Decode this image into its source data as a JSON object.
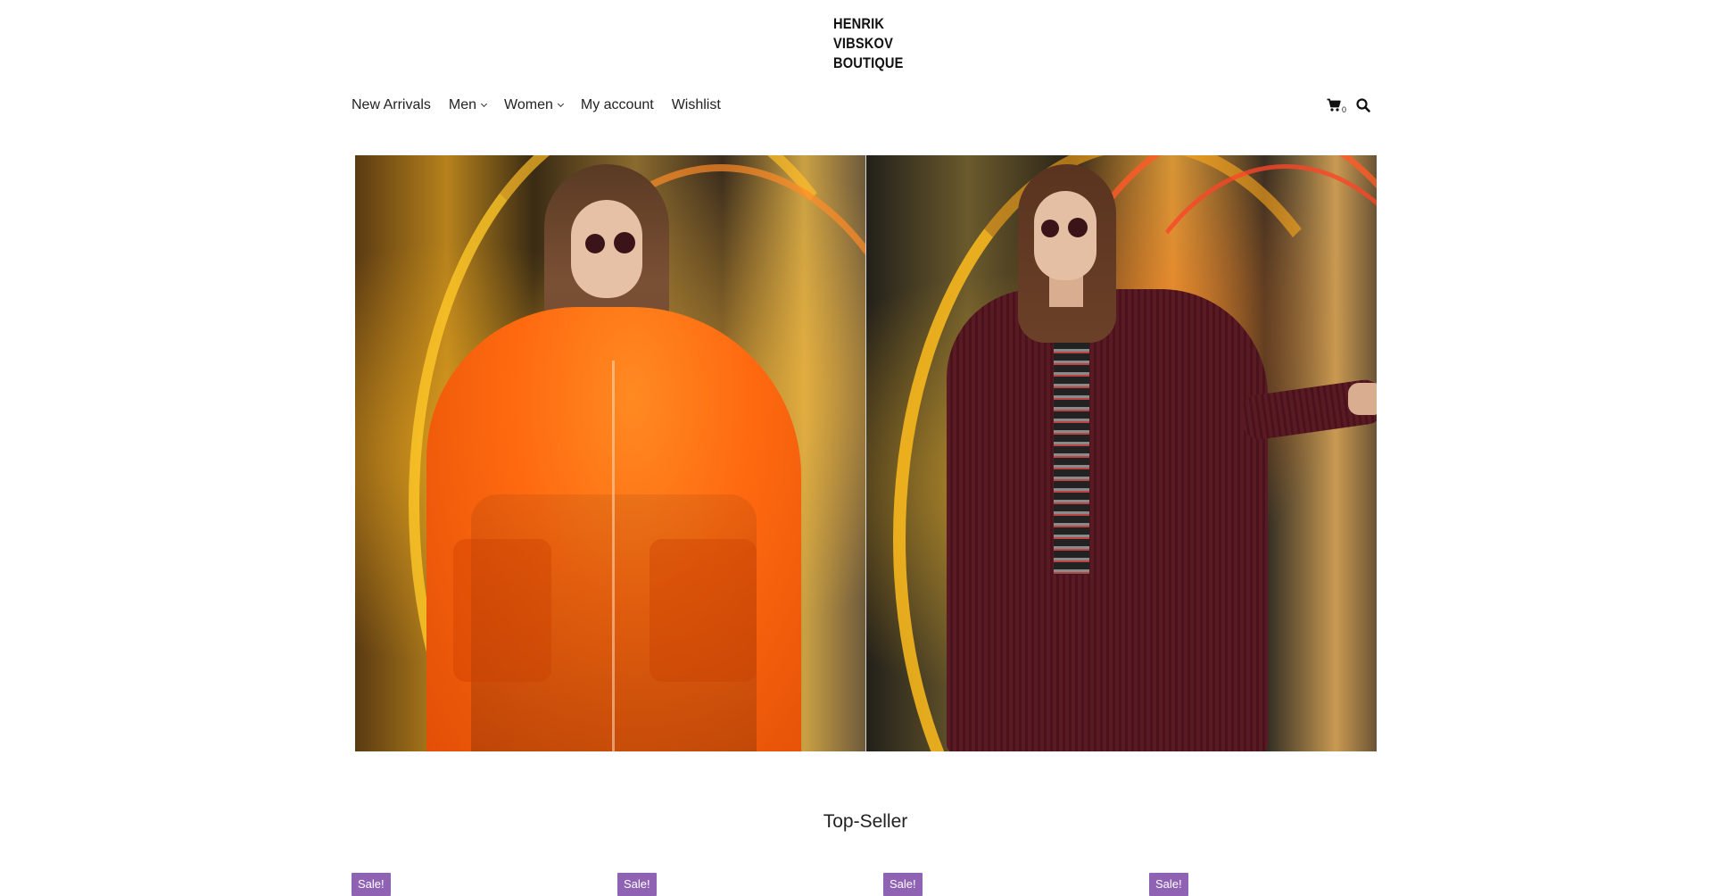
{
  "logo": {
    "lines": [
      "HENRIK",
      "VIBSKOV",
      "BOUTIQUE"
    ]
  },
  "nav": {
    "items": [
      {
        "label": "New Arrivals",
        "has_dropdown": false
      },
      {
        "label": "Men",
        "has_dropdown": true
      },
      {
        "label": "Women",
        "has_dropdown": true
      },
      {
        "label": "My account",
        "has_dropdown": false
      },
      {
        "label": "Wishlist",
        "has_dropdown": false
      }
    ]
  },
  "header": {
    "cart_count": "0",
    "cart_icon": "cart-icon",
    "search_icon": "search-icon"
  },
  "hero": {
    "panels": [
      "hero-image-left",
      "hero-image-right"
    ]
  },
  "sections": {
    "top_seller_title": "Top-Seller"
  },
  "products": {
    "badges": [
      "Sale!",
      "Sale!",
      "Sale!",
      "Sale!"
    ]
  },
  "colors": {
    "sale_badge": "#8f62b3",
    "text": "#222222",
    "background": "#ffffff"
  }
}
